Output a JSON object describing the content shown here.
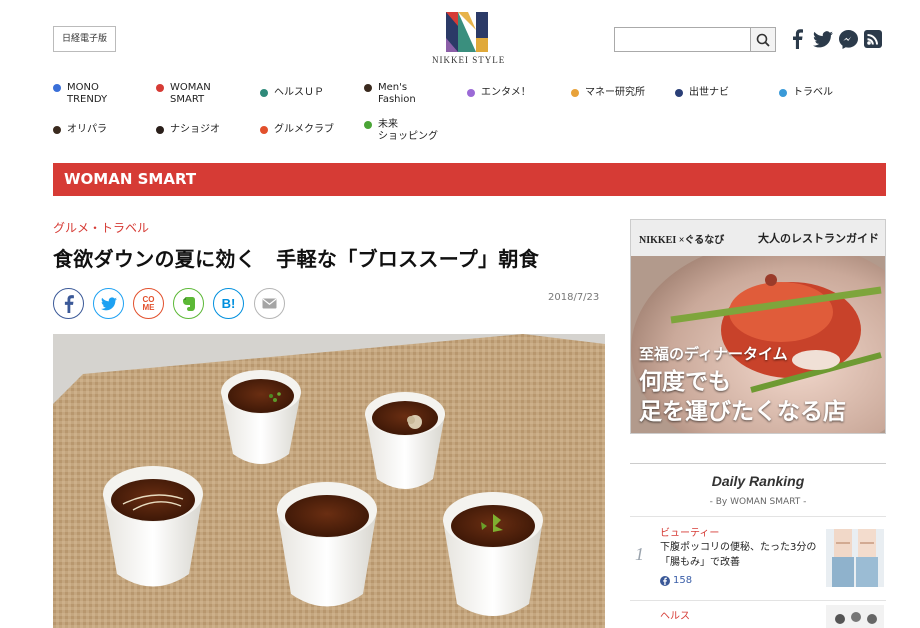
{
  "header": {
    "edition_label": "日経電子版",
    "logo_text": "NIKKEI STYLE",
    "search_placeholder": ""
  },
  "categories": [
    {
      "label": "MONO\nTRENDY",
      "color": "#3a6fd8"
    },
    {
      "label": "WOMAN\nSMART",
      "color": "#d63b35"
    },
    {
      "label": "ヘルスＵＰ",
      "color": "#2f8a7a"
    },
    {
      "label": "Men's\nFashion",
      "color": "#3a2a1e"
    },
    {
      "label": "エンタメ！",
      "color": "#9b6ad6"
    },
    {
      "label": "マネー研究所",
      "color": "#e8a23a"
    },
    {
      "label": "出世ナビ",
      "color": "#2a3f77"
    },
    {
      "label": "トラベル",
      "color": "#3a9ad8"
    },
    {
      "label": "オリパラ",
      "color": "#3a2a1e"
    },
    {
      "label": "ナショジオ",
      "color": "#2a1f1a"
    },
    {
      "label": "グルメクラブ",
      "color": "#e2502c"
    },
    {
      "label": "未来\nショッピング",
      "color": "#4aa436"
    }
  ],
  "section": {
    "title": "WOMAN SMART"
  },
  "article": {
    "kicker": "グルメ・トラベル",
    "headline": "食欲ダウンの夏に効く　手軽な「ブロススープ」朝食",
    "date": "2018/7/23",
    "share": {
      "come": "CO\nME",
      "hatena": "B!"
    }
  },
  "ad": {
    "brand": "NIKKEI ×ぐるなび",
    "title": "大人のレストランガイド",
    "line1": "至福のディナータイム",
    "line2": "何度でも",
    "line3": "足を運びたくなる店"
  },
  "ranking": {
    "title": "Daily Ranking",
    "subtitle": "- By WOMAN SMART -",
    "items": [
      {
        "rank": "1",
        "category": "ビューティー",
        "text": "下腹ポッコリの便秘、たった3分の「腸もみ」で改善",
        "likes": "158"
      },
      {
        "category": "ヘルス"
      }
    ]
  },
  "colors": {
    "accent": "#d63b35",
    "facebook": "#3b5998",
    "twitter": "#1da1f2",
    "evernote": "#5cb836",
    "hatena": "#008fde"
  }
}
